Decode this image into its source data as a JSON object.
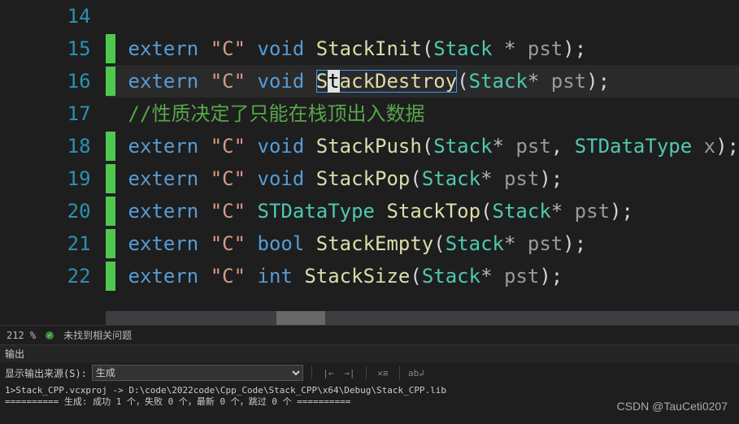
{
  "lines": {
    "14": "14",
    "15": "15",
    "16": "16",
    "17": "17",
    "18": "18",
    "19": "19",
    "20": "20",
    "21": "21",
    "22": "22"
  },
  "code": {
    "ext": "extern",
    "c_lit": "\"C\"",
    "void_kw": "void",
    "bool_kw": "bool",
    "int_kw": "int",
    "stack_t": "Stack",
    "std_t": "STDataType",
    "pst": "pst",
    "x": "x",
    "star": "*",
    "sp_star": " * ",
    "lp": "(",
    "rp": ")",
    "semi": ";",
    "comma": ", ",
    "fn_init": "StackInit",
    "fn_destroy_s": "S",
    "fn_destroy_t": "t",
    "fn_destroy_rest": "ackDestroy",
    "comment17": "//性质决定了只能在栈顶出入数据",
    "fn_push": "StackPush",
    "fn_pop": "StackPop",
    "fn_top": "StackTop",
    "fn_empty": "StackEmpty",
    "fn_size": "StackSize"
  },
  "zoom": "212 %",
  "issues": "未找到相关问题",
  "output_title": "输出",
  "output_source_label": "显示输出来源(S):",
  "output_source_value": "生成",
  "build_line1": "1>Stack_CPP.vcxproj -> D:\\code\\2022code\\Cpp_Code\\Stack_CPP\\x64\\Debug\\Stack_CPP.lib",
  "build_line2": "========== 生成: 成功 1 个，失败 0 个，最新 0 个，跳过 0 个 ==========",
  "watermark": "CSDN @TauCeti0207"
}
